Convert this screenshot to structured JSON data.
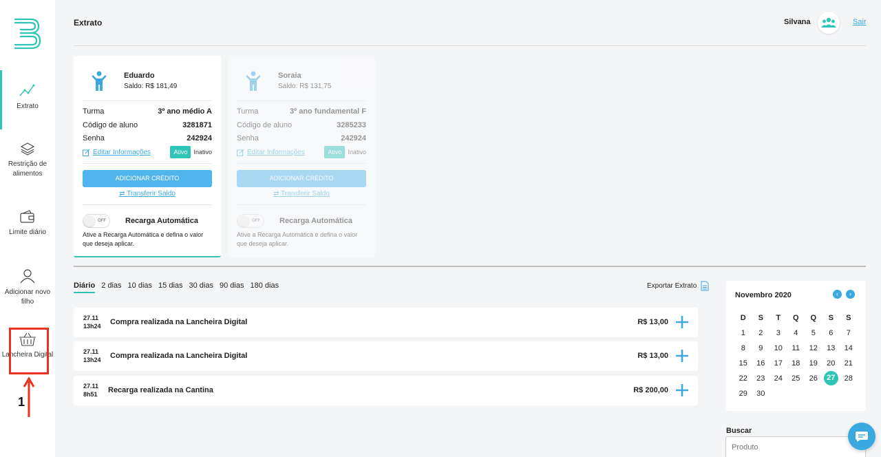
{
  "header": {
    "title": "Extrato",
    "user_name": "Silvana",
    "logout": "Sair"
  },
  "sidebar": {
    "items": [
      {
        "label": "Extrato",
        "icon": "chart-line-icon"
      },
      {
        "label": "Restrição de alimentos",
        "icon": "layers-icon"
      },
      {
        "label": "Limite diário",
        "icon": "wallet-icon"
      },
      {
        "label": "Adicionar novo filho",
        "icon": "user-icon"
      },
      {
        "label": "Lancheira Digital",
        "icon": "basket-icon"
      }
    ],
    "annotation_number": "1"
  },
  "children": [
    {
      "name": "Eduardo",
      "balance": "Saldo: R$ 181,49",
      "turma_label": "Turma",
      "turma": "3º ano médio A",
      "codigo_label": "Código de aluno",
      "codigo": "3281871",
      "senha_label": "Senha",
      "senha": "242924",
      "edit": "Editar Informações",
      "status_on": "Ativo",
      "status_off": "Inativo",
      "credit_btn": "ADICIONAR CRÉDITO",
      "transfer": "Transferir Saldo",
      "toggle": "OFF",
      "auto_title": "Recarga Automática",
      "auto_desc": "Ative a Recarga Automática e defina o valor que deseja aplicar."
    },
    {
      "name": "Soraia",
      "balance": "Saldo: R$ 131,75",
      "turma_label": "Turma",
      "turma": "3º ano fundamental F",
      "codigo_label": "Código de aluno",
      "codigo": "3285233",
      "senha_label": "Senha",
      "senha": "242924",
      "edit": "Editar Informações",
      "status_on": "Ativo",
      "status_off": "Inativo",
      "credit_btn": "ADICIONAR CRÉDITO",
      "transfer": "Transferir Saldo",
      "toggle": "OFF",
      "auto_title": "Recarga Automática",
      "auto_desc": "Ative a Recarga Automática e defina o valor que deseja aplicar."
    }
  ],
  "periods": [
    "Diário",
    "2 dias",
    "10 dias",
    "15 dias",
    "30 dias",
    "90 dias",
    "180 dias"
  ],
  "export_label": "Exportar Extrato",
  "transactions": [
    {
      "date": "27.11",
      "time": "13h24",
      "desc": "Compra realizada na Lancheira Digital",
      "amount": "R$ 13,00"
    },
    {
      "date": "27.11",
      "time": "13h24",
      "desc": "Compra realizada na Lancheira Digital",
      "amount": "R$ 13,00"
    },
    {
      "date": "27.11",
      "time": "8h51",
      "desc": "Recarga realizada na Cantina",
      "amount": "R$ 200,00"
    }
  ],
  "calendar": {
    "title": "Novembro 2020",
    "weekdays": [
      "D",
      "S",
      "T",
      "Q",
      "Q",
      "S",
      "S"
    ],
    "days": [
      "1",
      "2",
      "3",
      "4",
      "5",
      "6",
      "7",
      "8",
      "9",
      "10",
      "11",
      "12",
      "13",
      "14",
      "15",
      "16",
      "17",
      "18",
      "19",
      "20",
      "21",
      "22",
      "23",
      "24",
      "25",
      "26",
      "27",
      "28",
      "29",
      "30"
    ],
    "selected": "27"
  },
  "search": {
    "label": "Buscar",
    "placeholder": "Produto"
  },
  "colors": {
    "accent": "#2ec4b6",
    "blue": "#4fb5ec",
    "annotation": "#e8321e"
  }
}
